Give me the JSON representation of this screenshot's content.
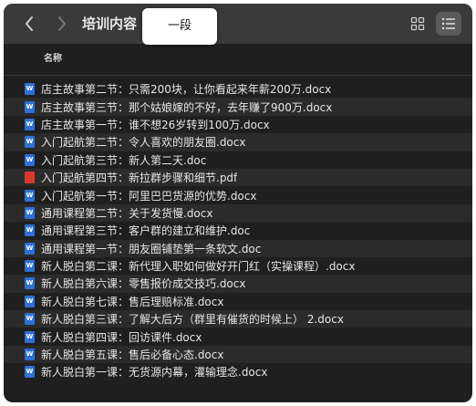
{
  "toolbar": {
    "title": "培训内容",
    "popup_label": "一段",
    "back_icon": "chevron-left-icon",
    "forward_icon": "chevron-right-icon",
    "grid_view_icon": "grid-icon",
    "list_view_icon": "list-icon"
  },
  "list_header": {
    "name_label": "名称"
  },
  "files": [
    {
      "name": "店主故事第二节：只需200块，让你看起来年薪200万.docx",
      "type": "docx"
    },
    {
      "name": "店主故事第三节：那个姑娘嫁的不好，去年赚了900万.docx",
      "type": "docx"
    },
    {
      "name": "店主故事第一节：谁不想26岁转到100万.docx",
      "type": "docx"
    },
    {
      "name": "入门起航第二节：令人喜欢的朋友圈.docx",
      "type": "docx"
    },
    {
      "name": "入门起航第三节：新人第二天.doc",
      "type": "doc"
    },
    {
      "name": "入门起航第四节：新拉群步骤和细节.pdf",
      "type": "pdf"
    },
    {
      "name": "入门起航第一节：阿里巴巴货源的优势.docx",
      "type": "docx"
    },
    {
      "name": "通用课程第二节：关于发货慢.docx",
      "type": "docx"
    },
    {
      "name": "通用课程第三节：客户群的建立和维护.doc",
      "type": "doc"
    },
    {
      "name": "通用课程第一节：朋友圈铺垫第一条软文.doc",
      "type": "doc"
    },
    {
      "name": "新人脱白第二课：新代理入职如何做好开门红（实操课程）.docx",
      "type": "docx"
    },
    {
      "name": "新人脱白第六课：零售报价成交技巧.docx",
      "type": "docx"
    },
    {
      "name": "新人脱白第七课：售后理赔标准.docx",
      "type": "docx"
    },
    {
      "name": "新人脱白第三课：了解大后方（群里有催货的时候上） 2.docx",
      "type": "docx"
    },
    {
      "name": "新人脱白第四课：回访课件.docx",
      "type": "docx"
    },
    {
      "name": "新人脱白第五课：售后必备心态.docx",
      "type": "docx"
    },
    {
      "name": "新人脱白第一课：无货源内幕，灌输理念.docx",
      "type": "docx"
    }
  ],
  "colors": {
    "toolbar": "#3a3a3a",
    "list_bg": "#1f1f1f",
    "row_alt": "#2b2b2b",
    "doc_icon": "#2f6fd6",
    "pdf_icon": "#d9382e"
  }
}
